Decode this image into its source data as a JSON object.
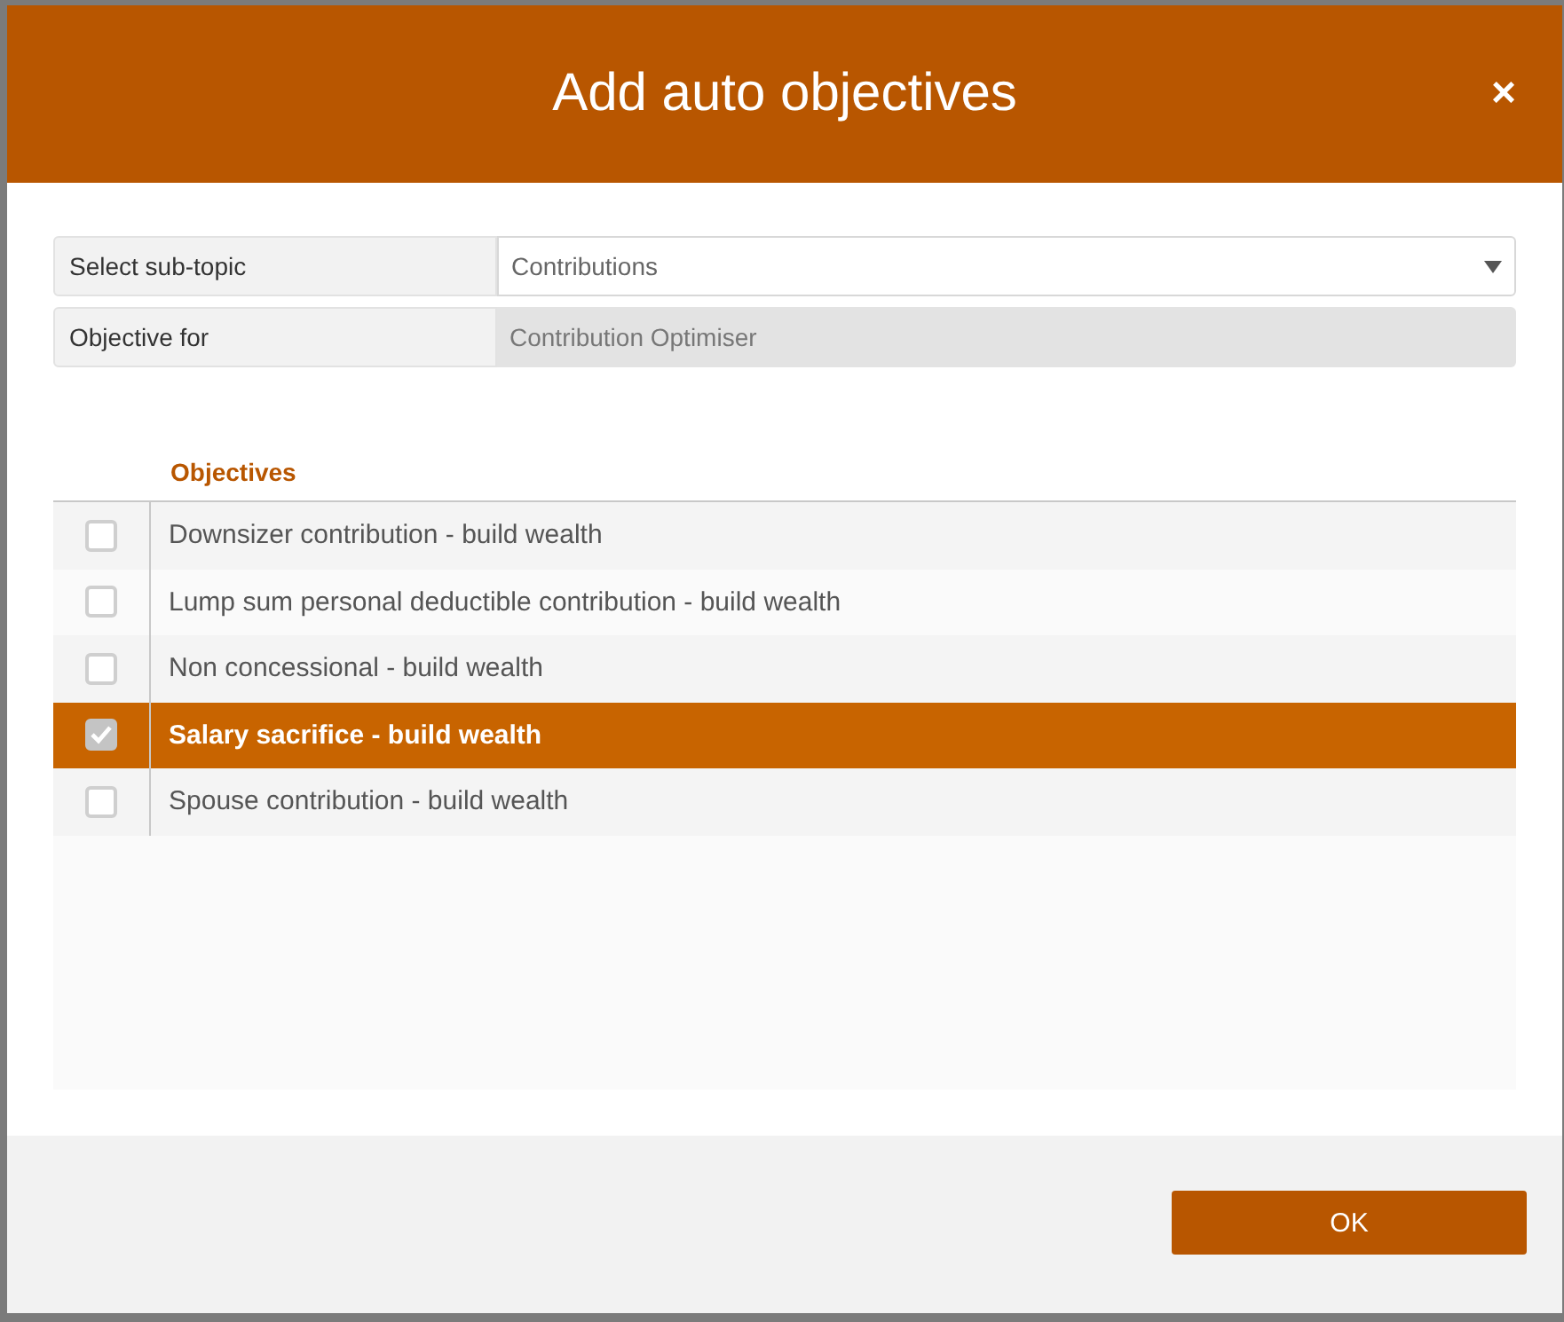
{
  "dialog": {
    "title": "Add auto objectives",
    "close": "×"
  },
  "fields": [
    {
      "kind": "select",
      "label": "Select sub-topic",
      "value": "Contributions"
    },
    {
      "kind": "readonly",
      "label": "Objective for",
      "value": "Contribution Optimiser"
    }
  ],
  "table": {
    "columns": [
      "Objectives"
    ],
    "rows": [
      {
        "label": "Downsizer contribution - build wealth",
        "checked": false,
        "selected": false
      },
      {
        "label": "Lump sum personal deductible contribution - build wealth",
        "checked": false,
        "selected": false
      },
      {
        "label": "Non concessional - build wealth",
        "checked": false,
        "selected": false
      },
      {
        "label": "Salary sacrifice - build wealth",
        "checked": true,
        "selected": true
      },
      {
        "label": "Spouse contribution - build wealth",
        "checked": false,
        "selected": false
      }
    ]
  },
  "buttons": [
    "OK"
  ]
}
